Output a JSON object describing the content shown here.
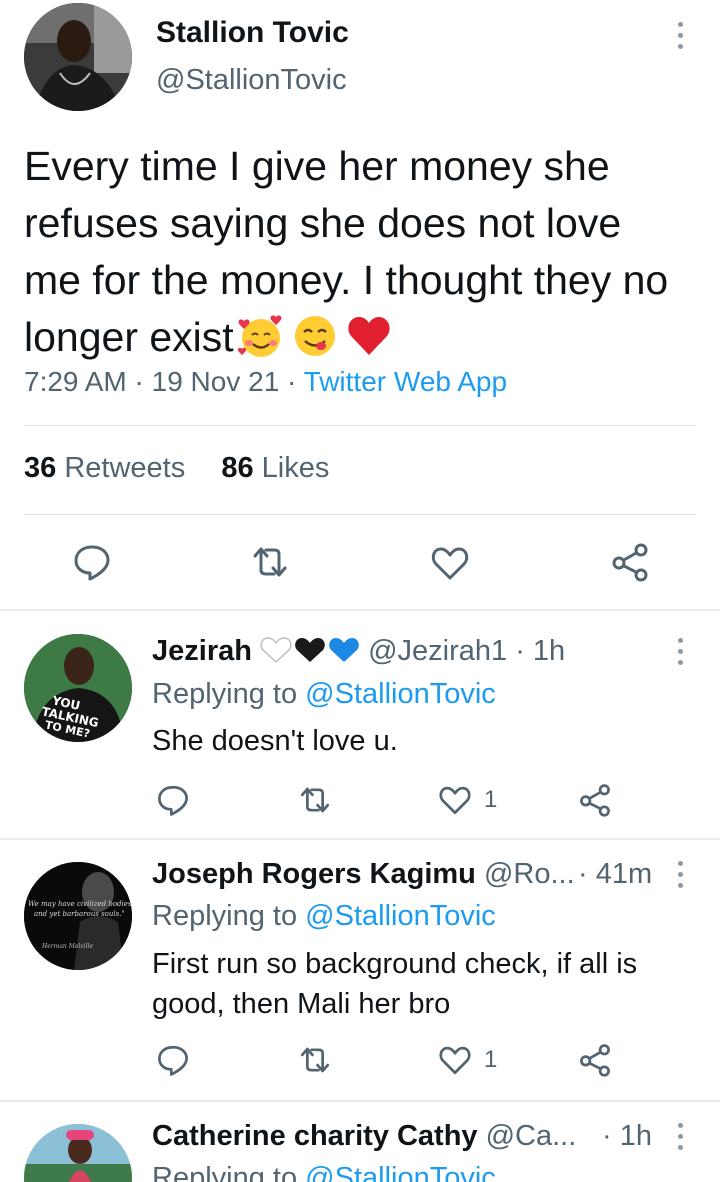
{
  "main_tweet": {
    "author_name": "Stallion Tovic",
    "handle": "@StallionTovic",
    "text": "Every time I give her money she refuses saying she does not love me for the money. I thought they no longer exist",
    "emojis": [
      "smiling-face-with-hearts",
      "face-savoring-food",
      "red-heart"
    ],
    "time": "7:29 AM",
    "date": "19 Nov 21",
    "separator": "·",
    "source": "Twitter Web App",
    "retweets_count": "36",
    "retweets_label": "Retweets",
    "likes_count": "86",
    "likes_label": "Likes"
  },
  "replies": [
    {
      "name": "Jezirah",
      "name_emojis": [
        "white-heart",
        "black-heart",
        "blue-heart"
      ],
      "handle": "@Jezirah1",
      "time": "· 1h",
      "replying_prefix": "Replying to",
      "replying_to": "@StallionTovic",
      "text": "She doesn't love u.",
      "likes": "1",
      "avatar_shirt_text": [
        "YOU",
        "TALKING",
        "TO ME?"
      ]
    },
    {
      "name": "Joseph Rogers Kagimu",
      "handle": "@Ro...",
      "time": "· 41m",
      "replying_prefix": "Replying to",
      "replying_to": "@StallionTovic",
      "text": "First run so background check, if all is good, then Mali her bro",
      "likes": "1",
      "avatar_quote": [
        "We may have civilized bodies",
        "and yet barbarous souls.\"",
        "Herman Melville"
      ]
    },
    {
      "name": "Catherine charity Cathy",
      "handle": "@Ca...",
      "time": "· 1h",
      "replying_prefix": "Replying to",
      "replying_to": "@StallionTovic"
    }
  ],
  "colors": {
    "accent": "#1d9bf0",
    "secondary_text": "#536471",
    "primary_text": "#0f1419",
    "divider": "#dfe3e6"
  }
}
